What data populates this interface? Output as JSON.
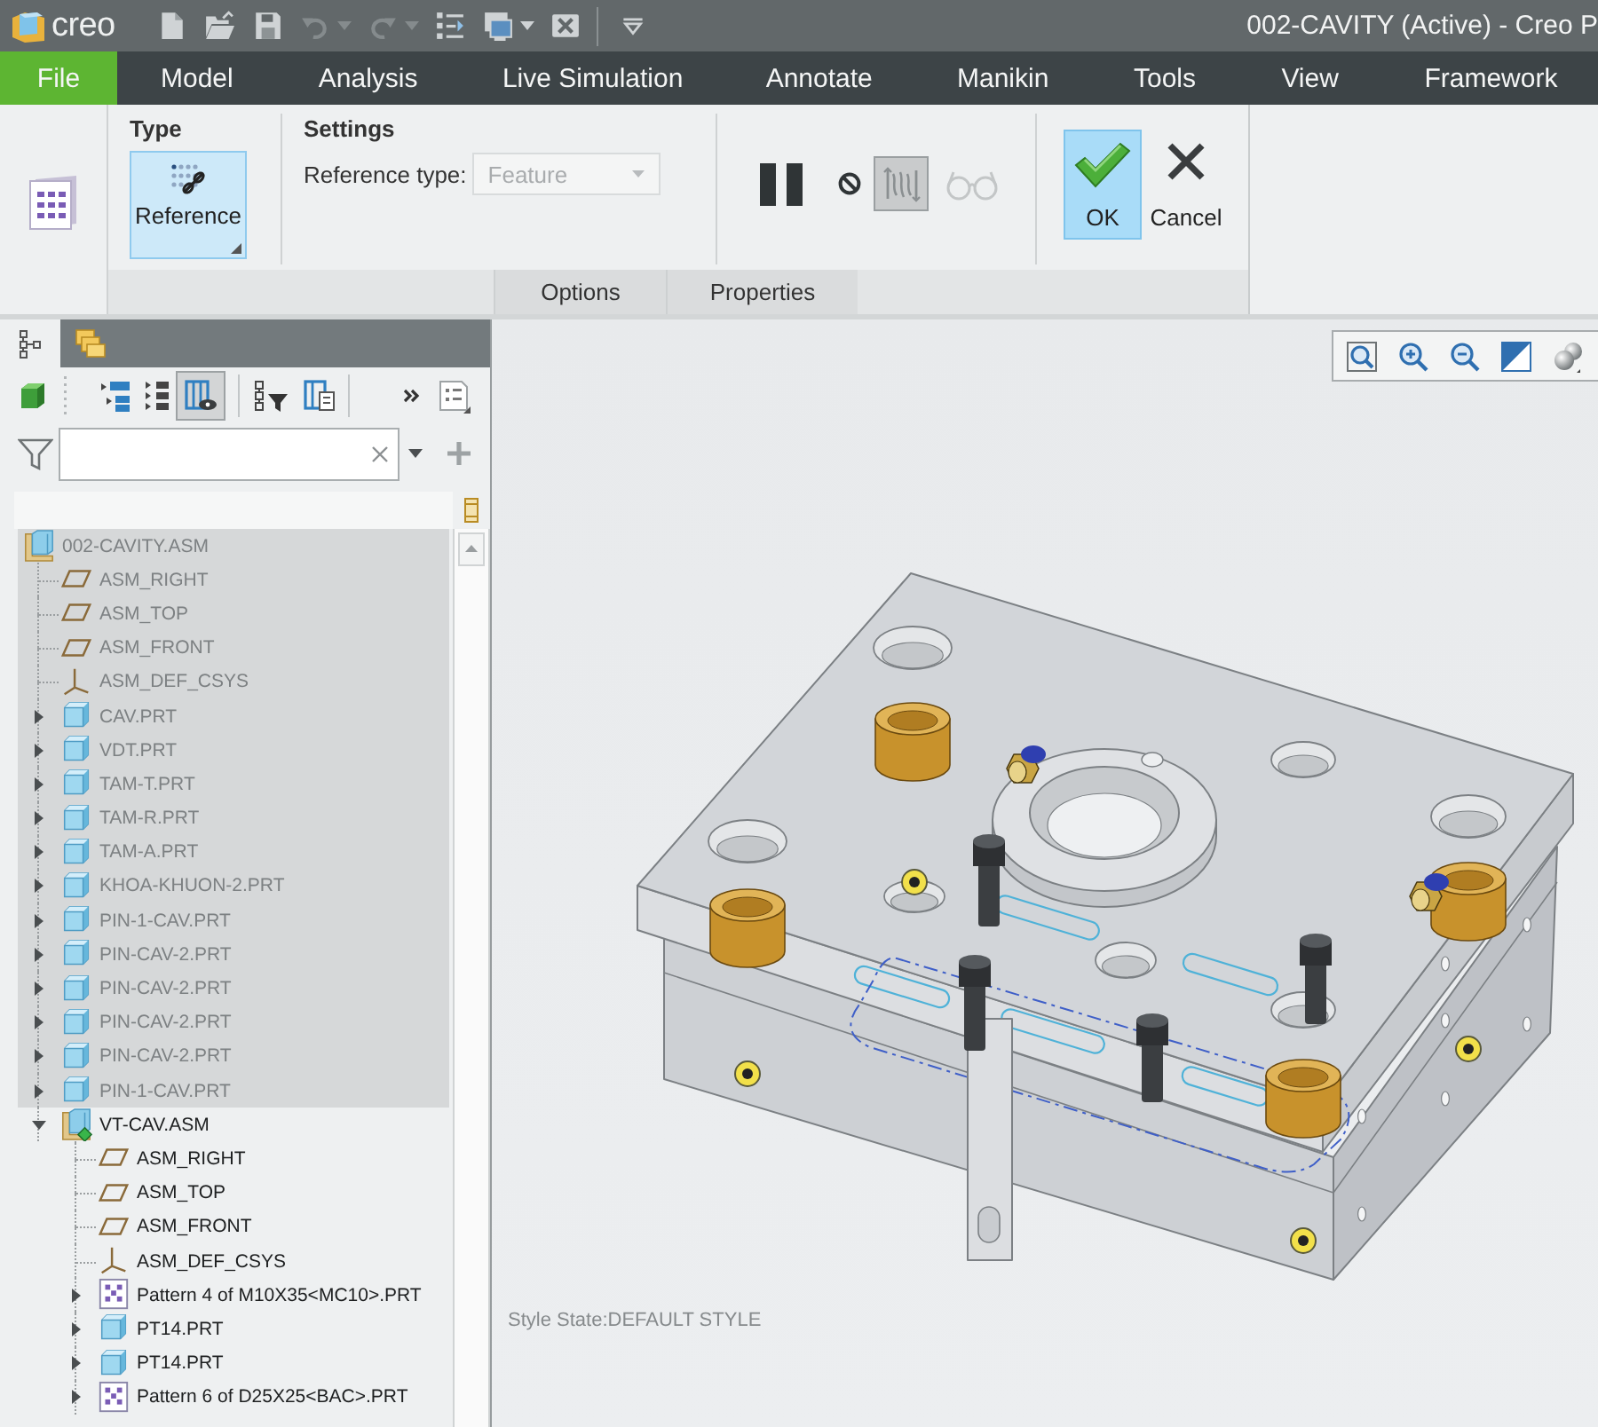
{
  "title_bar": {
    "logo": "creo",
    "quick_access": [
      {
        "kind": "new",
        "disabled": false
      },
      {
        "kind": "open",
        "disabled": false
      },
      {
        "kind": "save",
        "disabled": false
      },
      {
        "kind": "undo",
        "disabled": true
      },
      {
        "kind": "redo",
        "disabled": true
      },
      {
        "kind": "regenerate",
        "disabled": false
      },
      {
        "kind": "windows",
        "disabled": false
      },
      {
        "kind": "close",
        "disabled": false
      },
      {
        "kind": "customize",
        "disabled": false
      }
    ],
    "title": "002-CAVITY (Active) - Creo P"
  },
  "menu_bar": [
    {
      "label": "File",
      "kind": "app-menu",
      "selected": false
    },
    {
      "label": "Model",
      "kind": "tab",
      "selected": false
    },
    {
      "label": "Analysis",
      "kind": "tab",
      "selected": false
    },
    {
      "label": "Live Simulation",
      "kind": "tab",
      "selected": false
    },
    {
      "label": "Annotate",
      "kind": "tab",
      "selected": false
    },
    {
      "label": "Manikin",
      "kind": "tab",
      "selected": false
    },
    {
      "label": "Tools",
      "kind": "tab",
      "selected": false
    },
    {
      "label": "View",
      "kind": "tab",
      "selected": false
    },
    {
      "label": "Framework",
      "kind": "tab",
      "selected": false
    }
  ],
  "ribbon": {
    "type_group": {
      "title": "Type",
      "button": {
        "label": "Reference",
        "selected": true
      }
    },
    "settings_group": {
      "title": "Settings",
      "field": {
        "label": "Reference type:",
        "value": "Feature",
        "disabled": true
      }
    },
    "tools": [
      {
        "kind": "pause",
        "pressed": false,
        "disabled": false
      },
      {
        "kind": "no-entry",
        "pressed": false,
        "disabled": false
      },
      {
        "kind": "preview",
        "pressed": true,
        "disabled": false
      },
      {
        "kind": "glasses",
        "pressed": false,
        "disabled": true
      }
    ],
    "actions": [
      {
        "kind": "ok",
        "label": "OK",
        "highlighted": true
      },
      {
        "kind": "cancel",
        "label": "Cancel",
        "highlighted": false
      }
    ],
    "panel_tabs": [
      {
        "label": "Options",
        "selected": false
      },
      {
        "label": "Properties",
        "selected": false
      }
    ]
  },
  "model_tree_panel": {
    "tabs": [
      {
        "kind": "model-tree",
        "selected": true
      },
      {
        "kind": "folders",
        "selected": false
      }
    ],
    "toolbar": [
      {
        "kind": "solid",
        "pressed": false
      },
      {
        "kind": "grip",
        "pressed": false
      },
      {
        "kind": "tree-expand",
        "pressed": false
      },
      {
        "kind": "tree-list",
        "pressed": false
      },
      {
        "kind": "columns-view",
        "pressed": true
      },
      {
        "kind": "tree-filter",
        "pressed": false
      },
      {
        "kind": "columns-settings",
        "pressed": false
      },
      {
        "kind": "more",
        "pressed": false
      },
      {
        "kind": "settings",
        "pressed": false
      }
    ]
  },
  "model_tree": {
    "items": [
      {
        "label": "002-CAVITY.ASM",
        "kind": "assembly",
        "active": false,
        "dimmed": true,
        "children": [
          {
            "label": "ASM_RIGHT",
            "kind": "plane",
            "dimmed": true
          },
          {
            "label": "ASM_TOP",
            "kind": "plane",
            "dimmed": true
          },
          {
            "label": "ASM_FRONT",
            "kind": "plane",
            "dimmed": true
          },
          {
            "label": "ASM_DEF_CSYS",
            "kind": "csys",
            "dimmed": true
          },
          {
            "label": "CAV.PRT",
            "kind": "part",
            "expanded": false,
            "dimmed": true
          },
          {
            "label": "VDT.PRT",
            "kind": "part",
            "expanded": false,
            "dimmed": true
          },
          {
            "label": "TAM-T.PRT",
            "kind": "part",
            "expanded": false,
            "dimmed": true
          },
          {
            "label": "TAM-R.PRT",
            "kind": "part",
            "expanded": false,
            "dimmed": true
          },
          {
            "label": "TAM-A.PRT",
            "kind": "part",
            "expanded": false,
            "dimmed": true
          },
          {
            "label": "KHOA-KHUON-2.PRT",
            "kind": "part",
            "expanded": false,
            "dimmed": true
          },
          {
            "label": "PIN-1-CAV.PRT",
            "kind": "part",
            "expanded": false,
            "dimmed": true
          },
          {
            "label": "PIN-CAV-2.PRT",
            "kind": "part",
            "expanded": false,
            "dimmed": true
          },
          {
            "label": "PIN-CAV-2.PRT",
            "kind": "part",
            "expanded": false,
            "dimmed": true
          },
          {
            "label": "PIN-CAV-2.PRT",
            "kind": "part",
            "expanded": false,
            "dimmed": true
          },
          {
            "label": "PIN-CAV-2.PRT",
            "kind": "part",
            "expanded": false,
            "dimmed": true
          },
          {
            "label": "PIN-1-CAV.PRT",
            "kind": "part",
            "expanded": false,
            "dimmed": true
          },
          {
            "label": "VT-CAV.ASM",
            "kind": "assembly",
            "active": true,
            "expanded": true,
            "dimmed": false,
            "children": [
              {
                "label": "ASM_RIGHT",
                "kind": "plane",
                "dimmed": false
              },
              {
                "label": "ASM_TOP",
                "kind": "plane",
                "dimmed": false
              },
              {
                "label": "ASM_FRONT",
                "kind": "plane",
                "dimmed": false
              },
              {
                "label": "ASM_DEF_CSYS",
                "kind": "csys",
                "dimmed": false
              },
              {
                "label": "Pattern 4 of M10X35<MC10>.PRT",
                "kind": "pattern",
                "expanded": false,
                "dimmed": false
              },
              {
                "label": "PT14.PRT",
                "kind": "part",
                "expanded": false,
                "dimmed": false
              },
              {
                "label": "PT14.PRT",
                "kind": "part",
                "expanded": false,
                "dimmed": false
              },
              {
                "label": "Pattern 6 of D25X25<BAC>.PRT",
                "kind": "pattern",
                "expanded": false,
                "dimmed": false
              }
            ]
          }
        ]
      }
    ]
  },
  "viewport": {
    "toolbar": [
      {
        "kind": "refit"
      },
      {
        "kind": "zoom-in"
      },
      {
        "kind": "zoom-out"
      },
      {
        "kind": "repaint"
      },
      {
        "kind": "display-style"
      }
    ],
    "style_state": "Style State:DEFAULT STYLE"
  }
}
